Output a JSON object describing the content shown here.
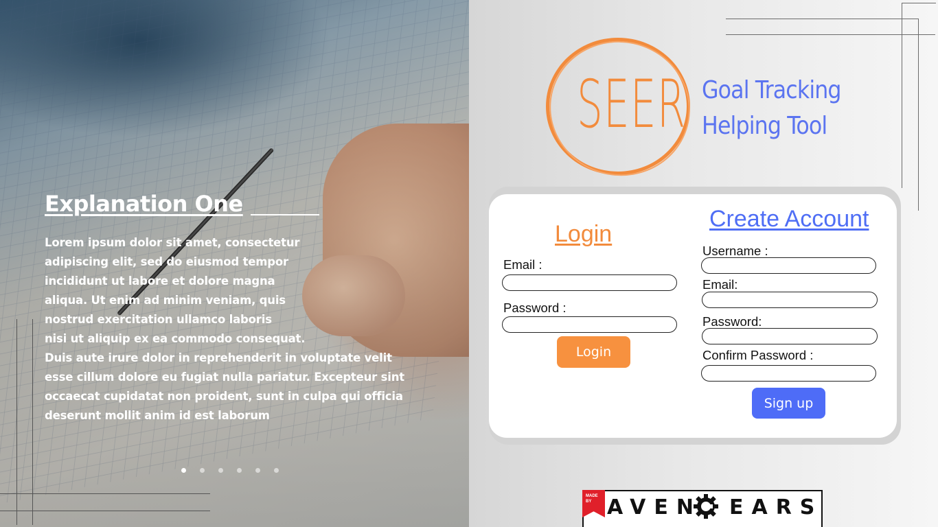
{
  "hero": {
    "title": "Explanation One",
    "body": "Lorem ipsum dolor sit amet, consectetur\nadipiscing elit, sed do eiusmod tempor\nincididunt ut labore et dolore magna\naliqua. Ut enim ad minim veniam, quis\nnostrud exercitation ullamco laboris\nnisi ut aliquip ex ea commodo consequat.\nDuis aute irure dolor in reprehenderit in voluptate velit\nesse cillum dolore eu fugiat nulla pariatur. Excepteur sint\noccaecat cupidatat non proident, sunt in culpa qui officia\ndeserunt mollit anim id est laborum",
    "carousel": {
      "count": 6,
      "active_index": 1
    }
  },
  "brand": {
    "logo_text": "SEER",
    "tagline_line1": "Goal Tracking",
    "tagline_line2": "Helping Tool",
    "accent_orange": "#f28b3c",
    "accent_blue": "#4e6cf7"
  },
  "login": {
    "title": "Login",
    "email_label": "Email :",
    "email_value": "",
    "password_label": "Password :",
    "password_value": "",
    "button_label": "Login"
  },
  "signup": {
    "title": "Create Account",
    "username_label": "Username :",
    "username_value": "",
    "email_label": "Email:",
    "email_value": "",
    "password_label": "Password:",
    "password_value": "",
    "confirm_label": "Confirm Password :",
    "confirm_value": "",
    "button_label": "Sign up"
  },
  "footer": {
    "made_by": "MADE BY",
    "company_left": "AVEN",
    "company_right": "EARS"
  }
}
